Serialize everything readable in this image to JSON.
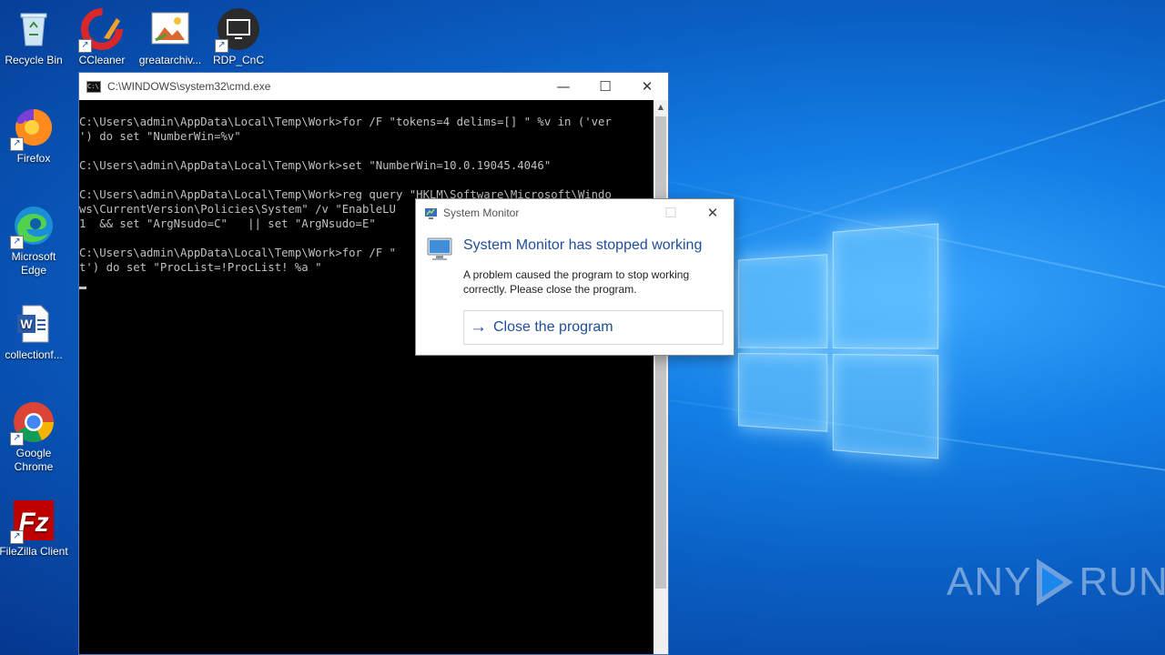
{
  "desktop": {
    "icons": [
      {
        "label": "Recycle Bin",
        "icon": "recycle-bin-icon"
      },
      {
        "label": "CCleaner",
        "icon": "ccleaner-icon"
      },
      {
        "label": "greatarchiv...",
        "icon": "image-file-icon"
      },
      {
        "label": "RDP_CnC",
        "icon": "rdp-icon"
      },
      {
        "label": "Firefox",
        "icon": "firefox-icon"
      },
      {
        "label": "Microsoft Edge",
        "icon": "edge-icon"
      },
      {
        "label": "collectionf...",
        "icon": "word-document-icon"
      },
      {
        "label": "Google Chrome",
        "icon": "chrome-icon"
      },
      {
        "label": "FileZilla Client",
        "icon": "filezilla-icon"
      }
    ],
    "watermark": {
      "left": "ANY",
      "right": "RUN"
    }
  },
  "cmd": {
    "title": "C:\\WINDOWS\\system32\\cmd.exe",
    "lines": [
      "C:\\Users\\admin\\AppData\\Local\\Temp\\Work>for /F \"tokens=4 delims=[] \" %v in ('ver",
      "') do set \"NumberWin=%v\"",
      "",
      "C:\\Users\\admin\\AppData\\Local\\Temp\\Work>set \"NumberWin=10.0.19045.4046\"",
      "",
      "C:\\Users\\admin\\AppData\\Local\\Temp\\Work>reg query \"HKLM\\Software\\Microsoft\\Windo",
      "ws\\CurrentVersion\\Policies\\System\" /v \"EnableLU",
      "1  && set \"ArgNsudo=C\"   || set \"ArgNsudo=E\"",
      "",
      "C:\\Users\\admin\\AppData\\Local\\Temp\\Work>for /F \"",
      "t') do set \"ProcList=!ProcList! %a \""
    ]
  },
  "dialog": {
    "title": "System Monitor",
    "heading": "System Monitor has stopped working",
    "message": "A problem caused the program to stop working correctly. Please close the program.",
    "action": "Close the program"
  }
}
